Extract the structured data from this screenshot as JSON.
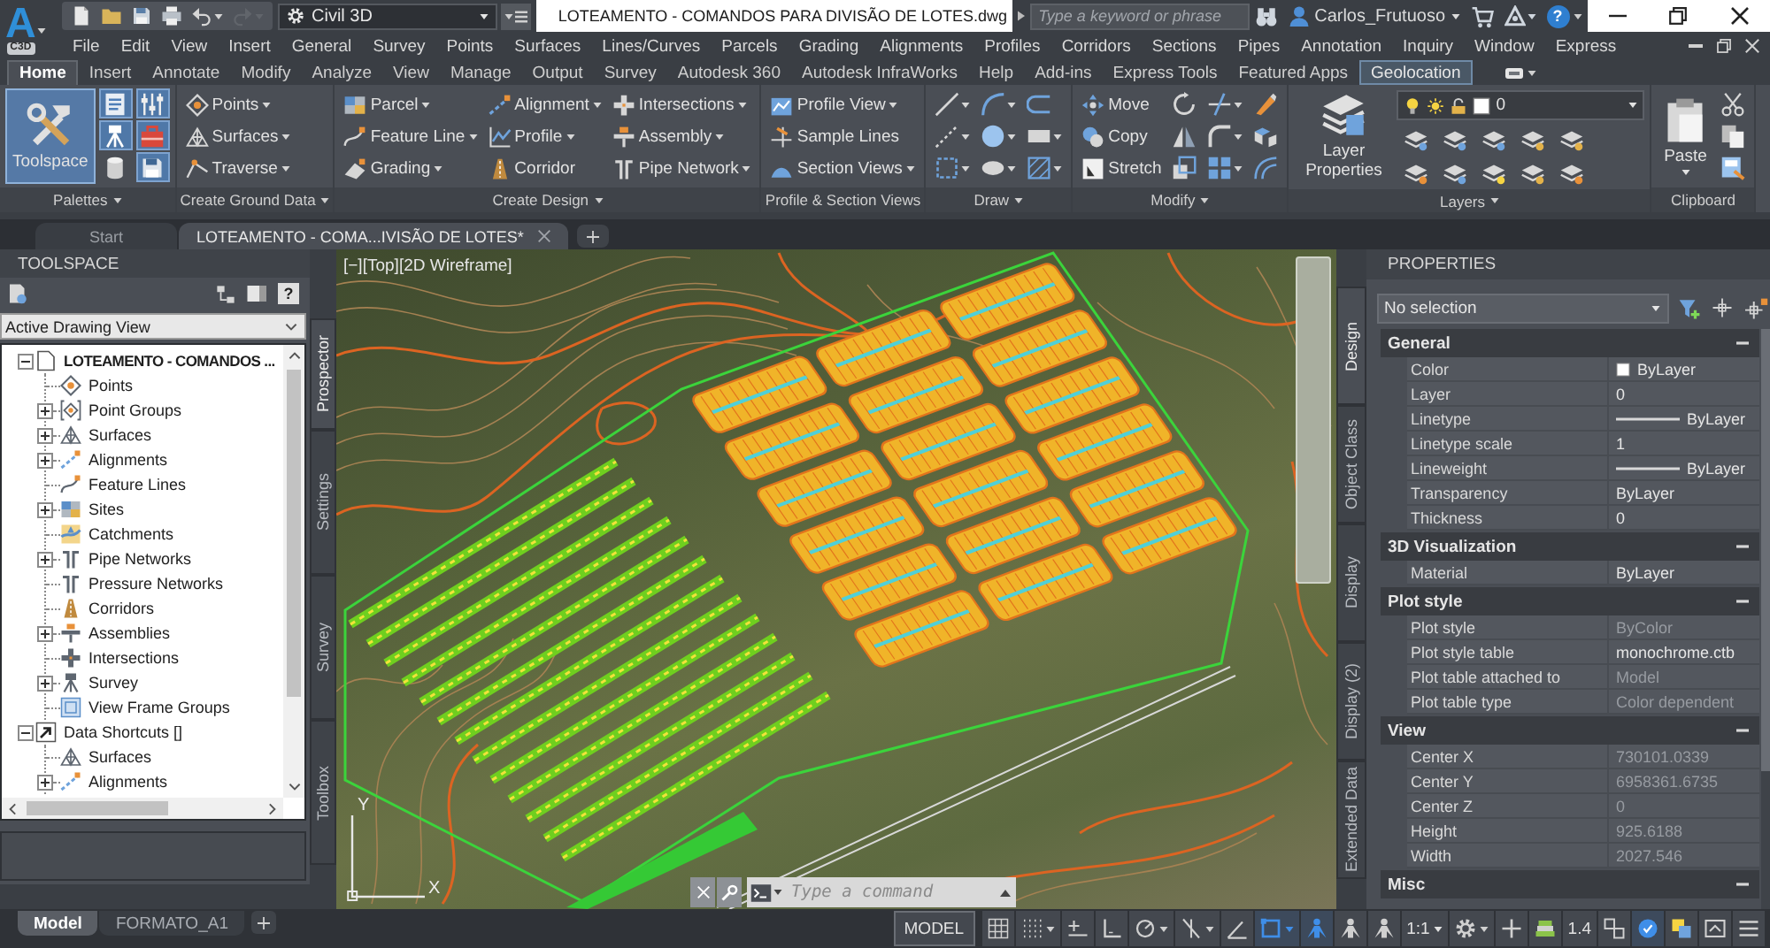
{
  "app_button": {
    "logo": "A",
    "badge": "C3D"
  },
  "quick_access": {
    "tools": [
      {
        "disabled": false,
        "dropdown": false
      },
      {
        "disabled": false,
        "dropdown": false
      },
      {
        "disabled": false,
        "dropdown": false
      },
      {
        "disabled": false,
        "dropdown": false
      },
      {
        "disabled": false,
        "dropdown": true
      },
      {
        "disabled": true,
        "dropdown": true
      }
    ],
    "workspace": "Civil 3D"
  },
  "window": {
    "title": "LOTEAMENTO - COMANDOS PARA DIVISÃO DE LOTES.dwg"
  },
  "search": {
    "placeholder": "Type a keyword or phrase"
  },
  "account": {
    "user": "Carlos_Frutuoso",
    "help": "?"
  },
  "menu": [
    "File",
    "Edit",
    "View",
    "Insert",
    "General",
    "Survey",
    "Points",
    "Surfaces",
    "Lines/Curves",
    "Parcels",
    "Grading",
    "Alignments",
    "Profiles",
    "Corridors",
    "Sections",
    "Pipes",
    "Annotation",
    "Inquiry",
    "Window",
    "Express"
  ],
  "ribbon": {
    "tabs": [
      {
        "label": "Home",
        "selected": true,
        "contextual": false
      },
      {
        "label": "Insert",
        "selected": false,
        "contextual": false
      },
      {
        "label": "Annotate",
        "selected": false,
        "contextual": false
      },
      {
        "label": "Modify",
        "selected": false,
        "contextual": false
      },
      {
        "label": "Analyze",
        "selected": false,
        "contextual": false
      },
      {
        "label": "View",
        "selected": false,
        "contextual": false
      },
      {
        "label": "Manage",
        "selected": false,
        "contextual": false
      },
      {
        "label": "Output",
        "selected": false,
        "contextual": false
      },
      {
        "label": "Survey",
        "selected": false,
        "contextual": false
      },
      {
        "label": "Autodesk 360",
        "selected": false,
        "contextual": false
      },
      {
        "label": "Autodesk InfraWorks",
        "selected": false,
        "contextual": false
      },
      {
        "label": "Help",
        "selected": false,
        "contextual": false
      },
      {
        "label": "Add-ins",
        "selected": false,
        "contextual": false
      },
      {
        "label": "Express Tools",
        "selected": false,
        "contextual": false
      },
      {
        "label": "Featured Apps",
        "selected": false,
        "contextual": false
      },
      {
        "label": "Geolocation",
        "selected": false,
        "contextual": true
      }
    ],
    "panels": [
      {
        "label": "Palettes",
        "dropdown": true,
        "big": {
          "label": "Toolspace",
          "on": true
        },
        "columns": [
          [
            {
              "on": true
            },
            {
              "on": true
            },
            {
              "on": false
            }
          ],
          [
            {
              "on": true
            },
            {
              "on": true
            },
            {
              "on": true
            }
          ]
        ]
      },
      {
        "label": "Create Ground Data",
        "dropdown": true,
        "columns": [
          [
            {
              "label": "Points",
              "dropdown": true
            },
            {
              "label": "Surfaces",
              "dropdown": true
            },
            {
              "label": "Traverse",
              "dropdown": true
            }
          ]
        ]
      },
      {
        "label": "Create Design",
        "dropdown": true,
        "columns": [
          [
            {
              "label": "Parcel",
              "dropdown": true
            },
            {
              "label": "Feature Line",
              "dropdown": true
            },
            {
              "label": "Grading",
              "dropdown": true
            }
          ],
          [
            {
              "label": "Alignment",
              "dropdown": true
            },
            {
              "label": "Profile",
              "dropdown": true
            },
            {
              "label": "Corridor",
              "dropdown": false
            }
          ],
          [
            {
              "label": "Intersections",
              "dropdown": true
            },
            {
              "label": "Assembly",
              "dropdown": true
            },
            {
              "label": "Pipe Network",
              "dropdown": true
            }
          ]
        ]
      },
      {
        "label": "Profile & Section Views",
        "dropdown": false,
        "columns": [
          [
            {
              "label": "Profile View",
              "dropdown": true
            },
            {
              "label": "Sample Lines",
              "dropdown": false
            },
            {
              "label": "Section Views",
              "dropdown": true
            }
          ]
        ]
      },
      {
        "label": "Draw",
        "dropdown": true,
        "columns": [
          [
            {
              "dropdown": true
            },
            {
              "dropdown": true
            },
            {
              "dropdown": true
            }
          ],
          [
            {
              "dropdown": true
            },
            {
              "dropdown": true
            },
            {
              "dropdown": true
            }
          ],
          [
            {
              "dropdown": false
            },
            {
              "dropdown": true
            },
            {
              "dropdown": true
            }
          ]
        ]
      },
      {
        "label": "Modify",
        "dropdown": true,
        "columns": [
          [
            {
              "label": "Move",
              "dropdown": false
            },
            {
              "label": "Copy",
              "dropdown": false
            },
            {
              "label": "Stretch",
              "dropdown": false
            }
          ],
          [
            {
              "dropdown": false
            },
            {
              "dropdown": false
            },
            {
              "dropdown": false
            }
          ],
          [
            {
              "dropdown": true
            },
            {
              "dropdown": true
            },
            {
              "dropdown": true
            }
          ],
          [
            {
              "dropdown": false
            },
            {
              "dropdown": false
            },
            {
              "dropdown": false
            }
          ]
        ]
      },
      {
        "label": "Layers",
        "dropdown": true,
        "big": {
          "label": "Layer Properties",
          "dropdown": false
        },
        "field": {
          "value": "0"
        },
        "columns": [
          [
            {
              "dropdown": false
            },
            {
              "dropdown": false
            }
          ],
          [
            {
              "dropdown": false
            },
            {
              "dropdown": false
            }
          ],
          [
            {
              "dropdown": false
            },
            {
              "dropdown": false
            }
          ],
          [
            {
              "dropdown": false
            },
            {
              "dropdown": false
            }
          ],
          [
            {
              "dropdown": false
            },
            {
              "dropdown": false
            }
          ]
        ]
      },
      {
        "label": "Clipboard",
        "dropdown": false,
        "big": {
          "label": "Paste",
          "dropdown": true
        },
        "columns": [
          [
            {
              "dropdown": false
            },
            {
              "dropdown": false
            },
            {
              "dropdown": false
            }
          ]
        ]
      }
    ]
  },
  "file_tabs": {
    "tabs": [
      {
        "label": "Start",
        "selected": false,
        "closable": false
      },
      {
        "label": "LOTEAMENTO - COMA...IVISÃO DE LOTES*",
        "selected": true,
        "closable": true
      }
    ]
  },
  "toolspace": {
    "title": "TOOLSPACE",
    "help": "?",
    "view": "Active Drawing View",
    "tree": [
      {
        "label": "LOTEAMENTO - COMANDOS ...",
        "kind": "drawing",
        "expanded": true,
        "children": [
          {
            "label": "Points"
          },
          {
            "label": "Point Groups",
            "expanded": false
          },
          {
            "label": "Surfaces",
            "expanded": false
          },
          {
            "label": "Alignments",
            "expanded": false
          },
          {
            "label": "Feature Lines"
          },
          {
            "label": "Sites",
            "expanded": false
          },
          {
            "label": "Catchments"
          },
          {
            "label": "Pipe Networks",
            "expanded": false
          },
          {
            "label": "Pressure Networks"
          },
          {
            "label": "Corridors"
          },
          {
            "label": "Assemblies",
            "expanded": false
          },
          {
            "label": "Intersections"
          },
          {
            "label": "Survey",
            "expanded": false
          },
          {
            "label": "View Frame Groups"
          }
        ]
      },
      {
        "label": "Data Shortcuts []",
        "kind": "shortcuts",
        "expanded": true,
        "children": [
          {
            "label": "Surfaces"
          },
          {
            "label": "Alignments",
            "expanded": false
          }
        ]
      }
    ],
    "tabs": [
      {
        "label": "Prospector",
        "selected": true
      },
      {
        "label": "Settings",
        "selected": false
      },
      {
        "label": "Survey",
        "selected": false
      },
      {
        "label": "Toolbox",
        "selected": false
      }
    ]
  },
  "viewport": {
    "controls": [
      "[−]",
      "[Top]",
      "[2D Wireframe]"
    ],
    "ucs": {
      "y": "Y",
      "x": "X"
    },
    "command_line": {
      "placeholder": "Type a command"
    }
  },
  "properties": {
    "title": "PROPERTIES",
    "selection": "No selection",
    "sections": [
      {
        "title": "General",
        "expanded": true,
        "rows": [
          {
            "name": "Color",
            "value": "ByLayer",
            "kind": "swatch",
            "disabled": false
          },
          {
            "name": "Layer",
            "value": "0",
            "kind": "text",
            "disabled": false
          },
          {
            "name": "Linetype",
            "value": "ByLayer",
            "kind": "line",
            "disabled": false
          },
          {
            "name": "Linetype scale",
            "value": "1",
            "kind": "text",
            "disabled": false
          },
          {
            "name": "Lineweight",
            "value": "ByLayer",
            "kind": "line",
            "disabled": false
          },
          {
            "name": "Transparency",
            "value": "ByLayer",
            "kind": "text",
            "disabled": false
          },
          {
            "name": "Thickness",
            "value": "0",
            "kind": "text",
            "disabled": false
          }
        ]
      },
      {
        "title": "3D Visualization",
        "expanded": true,
        "rows": [
          {
            "name": "Material",
            "value": "ByLayer",
            "kind": "text",
            "disabled": false
          }
        ]
      },
      {
        "title": "Plot style",
        "expanded": true,
        "rows": [
          {
            "name": "Plot style",
            "value": "ByColor",
            "kind": "text",
            "disabled": true
          },
          {
            "name": "Plot style table",
            "value": "monochrome.ctb",
            "kind": "text",
            "disabled": false
          },
          {
            "name": "Plot table attached to",
            "value": "Model",
            "kind": "text",
            "disabled": true
          },
          {
            "name": "Plot table type",
            "value": "Color dependent",
            "kind": "text",
            "disabled": true
          }
        ]
      },
      {
        "title": "View",
        "expanded": true,
        "rows": [
          {
            "name": "Center X",
            "value": "730101.0339",
            "kind": "text",
            "disabled": true
          },
          {
            "name": "Center Y",
            "value": "6958361.6735",
            "kind": "text",
            "disabled": true
          },
          {
            "name": "Center Z",
            "value": "0",
            "kind": "text",
            "disabled": true
          },
          {
            "name": "Height",
            "value": "925.6188",
            "kind": "text",
            "disabled": true
          },
          {
            "name": "Width",
            "value": "2027.546",
            "kind": "text",
            "disabled": true
          }
        ]
      },
      {
        "title": "Misc",
        "expanded": true
      }
    ],
    "tabs": [
      {
        "label": "Design",
        "selected": true
      },
      {
        "label": "Object Class",
        "selected": false
      },
      {
        "label": "Display",
        "selected": false
      },
      {
        "label": "Display (2)",
        "selected": false
      },
      {
        "label": "Extended Data",
        "selected": false
      }
    ]
  },
  "status_bar": {
    "layout_tabs": [
      {
        "label": "Model",
        "selected": true
      },
      {
        "label": "FORMATO_A1",
        "selected": false
      }
    ],
    "controls": [
      {
        "kind": "text",
        "label": "MODEL",
        "dropdown": false
      },
      {
        "kind": "toggle",
        "on": false,
        "dropdown": false
      },
      {
        "kind": "toggle",
        "on": false,
        "dropdown": true
      },
      {
        "kind": "toggle",
        "on": false,
        "dropdown": false
      },
      {
        "kind": "toggle",
        "on": false,
        "dropdown": false
      },
      {
        "kind": "toggle",
        "on": false,
        "dropdown": true
      },
      {
        "kind": "toggle",
        "on": false,
        "dropdown": true
      },
      {
        "kind": "toggle",
        "on": false,
        "dropdown": false
      },
      {
        "kind": "toggle",
        "on": true,
        "dropdown": true
      },
      {
        "kind": "toggle",
        "on": true,
        "dropdown": false
      },
      {
        "kind": "toggle",
        "on": false,
        "dropdown": false
      },
      {
        "kind": "toggle",
        "on": false,
        "dropdown": false
      },
      {
        "kind": "text",
        "label": "1:1",
        "dropdown": true
      },
      {
        "kind": "toggle",
        "on": false,
        "dropdown": true
      },
      {
        "kind": "toggle",
        "on": false,
        "dropdown": false
      },
      {
        "kind": "toggle",
        "on": false,
        "dropdown": false
      },
      {
        "kind": "text",
        "label": "1.4",
        "dropdown": false
      },
      {
        "kind": "toggle",
        "on": false,
        "dropdown": false
      },
      {
        "kind": "toggle",
        "on": true,
        "dropdown": false
      },
      {
        "kind": "toggle",
        "on": false,
        "dropdown": false
      },
      {
        "kind": "toggle",
        "on": false,
        "dropdown": false
      },
      {
        "kind": "toggle",
        "on": false,
        "dropdown": false
      }
    ]
  }
}
